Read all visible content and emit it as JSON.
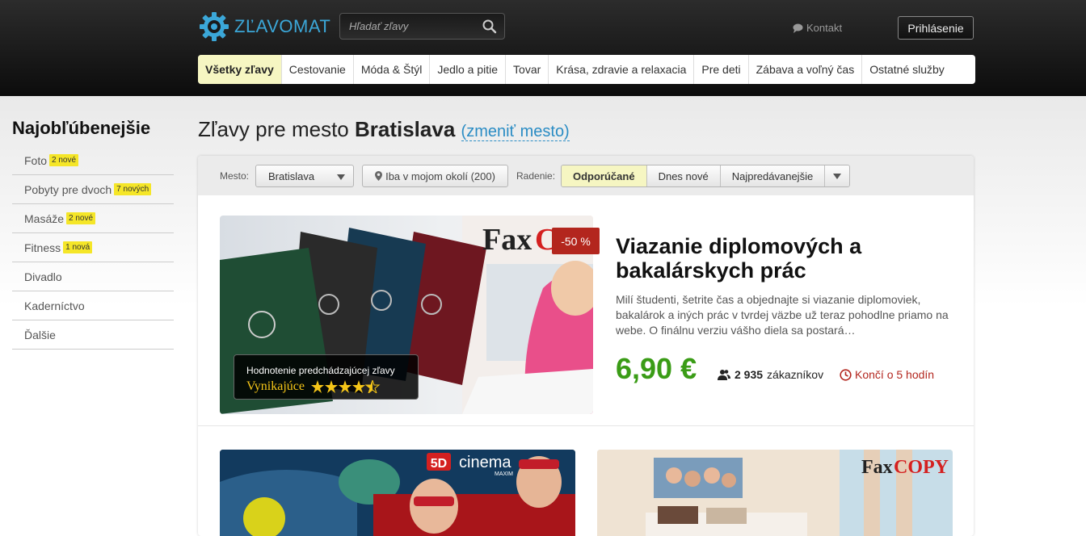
{
  "header": {
    "logo_text": "ZĽAVOMAT",
    "search_placeholder": "Hľadať zľavy",
    "contact_label": "Kontakt",
    "login_label": "Prihlásenie"
  },
  "nav": {
    "items": [
      {
        "label": "Všetky zľavy",
        "active": true
      },
      {
        "label": "Cestovanie"
      },
      {
        "label": "Móda & Štýl"
      },
      {
        "label": "Jedlo a pitie"
      },
      {
        "label": "Tovar"
      },
      {
        "label": "Krása, zdravie a relaxacia"
      },
      {
        "label": "Pre deti"
      },
      {
        "label": "Zábava a voľný čas"
      },
      {
        "label": "Ostatné služby"
      }
    ]
  },
  "sidebar": {
    "title": "Najobľúbenejšie",
    "items": [
      {
        "label": "Foto",
        "badge": "2 nové"
      },
      {
        "label": "Pobyty pre dvoch",
        "badge": "7 nových"
      },
      {
        "label": "Masáže",
        "badge": "2 nové"
      },
      {
        "label": "Fitness",
        "badge": "1 nová"
      },
      {
        "label": "Divadlo"
      },
      {
        "label": "Kaderníctvo"
      },
      {
        "label": "Ďalšie"
      }
    ]
  },
  "page": {
    "title_prefix": "Zľavy pre mesto",
    "city": "Bratislava",
    "change_link": "(zmeniť mesto)"
  },
  "filters": {
    "city_label": "Mesto:",
    "city_value": "Bratislava",
    "nearby_label": "Iba v mojom okolí (200)",
    "sort_label": "Radenie:",
    "sort_options": [
      {
        "label": "Odporúčané",
        "active": true
      },
      {
        "label": "Dnes nové"
      },
      {
        "label": "Najpredávanejšie"
      }
    ]
  },
  "featured_deal": {
    "brand_logo": "FaxCOPY",
    "discount": "-50 %",
    "rating_title": "Hodnotenie predchádzajúcej zľavy",
    "rating_label": "Vynikajúce",
    "rating_stars": 4.5,
    "title": "Viazanie diplomových a bakalárskych prác",
    "description": "Milí študenti, šetrite čas a objednajte si viazanie diplomoviek, bakalárok a iných prác v tvrdej väzbe už teraz pohodlne priamo na webe. O finálnu verziu vášho diela sa postará…",
    "price": "6,90 €",
    "customers_count": "2 935",
    "customers_label": "zákazníkov",
    "ends_label": "Končí o 5 hodín"
  },
  "more_deals": [
    {
      "brand_logo": "5D cinema",
      "brand_sub": "MAXIM"
    },
    {
      "brand_logo": "FaxCOPY"
    }
  ],
  "colors": {
    "accent_blue": "#3ba7d8",
    "link_blue": "#2a8cc4",
    "price_green": "#3a9c16",
    "discount_red": "#b3261e",
    "badge_yellow": "#f5e628",
    "active_nav": "#f6f6c2"
  }
}
